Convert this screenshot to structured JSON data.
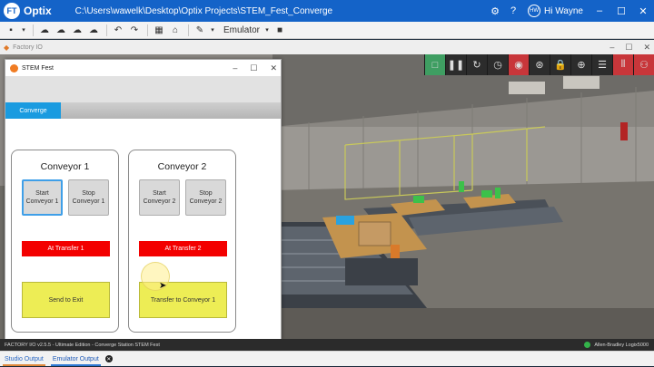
{
  "app": {
    "logo_text": "FT",
    "name": "Optix",
    "path": "C:\\Users\\wawelk\\Desktop\\Optix Projects\\STEM_Fest_Converge",
    "user": "Hi Wayne",
    "user_initials": "HW"
  },
  "toolbar": {
    "emulator_label": "Emulator"
  },
  "factory_window": {
    "title": "Factory IO"
  },
  "hmi": {
    "title": "STEM Fest",
    "tab": "Converge",
    "conveyor1": {
      "title": "Conveyor 1",
      "start": "Start Conveyor 1",
      "stop": "Stop Conveyor 1",
      "status": "At Transfer 1",
      "action": "Send to Exit"
    },
    "conveyor2": {
      "title": "Conveyor 2",
      "start": "Start Conveyor 2",
      "stop": "Stop Conveyor 2",
      "status": "At Transfer 2",
      "action": "Transfer to Conveyor 1"
    }
  },
  "status": {
    "left": "FACTORY I/O v2.5.5 - Ultimate Edition - Converge Station STEM Fest",
    "driver": "Allen-Bradley Logix5000"
  },
  "bottom_tabs": [
    "Studio Output",
    "Emulator Output"
  ],
  "colors": {
    "accent": "#1463c8",
    "status_red": "#f30000",
    "button_yellow": "#eded55",
    "tab_blue": "#1a9be0"
  }
}
